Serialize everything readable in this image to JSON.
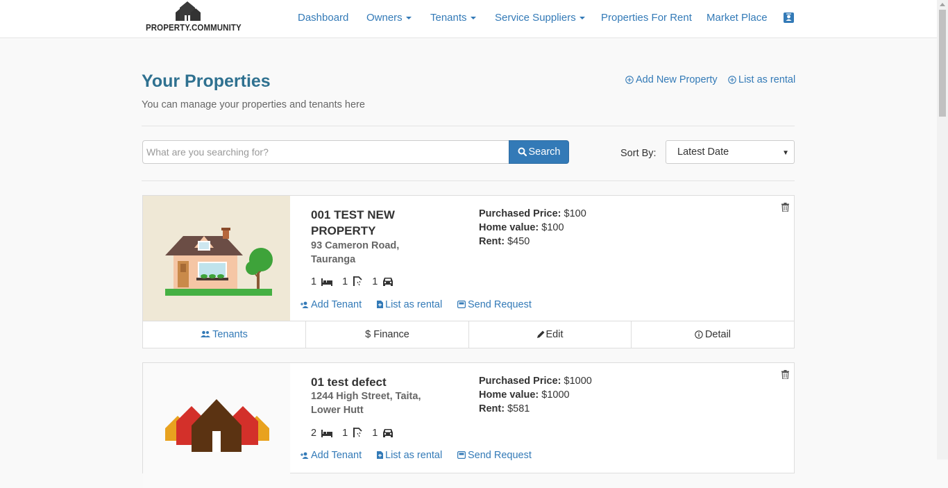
{
  "brand": {
    "name": "PROPERTY.COMMUNITY"
  },
  "nav": {
    "dashboard": "Dashboard",
    "owners": "Owners",
    "tenants": "Tenants",
    "service_suppliers": "Service Suppliers",
    "properties_for_rent": "Properties For Rent",
    "market_place": "Market Place",
    "profile_icon": "contact-card-icon"
  },
  "header": {
    "title": "Your Properties",
    "subtitle": "You can manage your properties and tenants here",
    "add_new_property": "Add New Property",
    "list_as_rental": "List as rental"
  },
  "search": {
    "placeholder": "What are you searching for?",
    "value": "",
    "button_label": "Search",
    "sort_label": "Sort By:",
    "sort_value": "Latest Date"
  },
  "properties": [
    {
      "name": "001 TEST NEW PROPERTY",
      "address": "93 Cameron Road, Tauranga",
      "purchased_price_label": "Purchased Price:",
      "purchased_price": "$100",
      "home_value_label": "Home value:",
      "home_value": "$100",
      "rent_label": "Rent:",
      "rent": "$450",
      "beds": "1",
      "baths": "1",
      "parking": "1",
      "actions": {
        "add_tenant": "Add Tenant",
        "list_as_rental": "List as rental",
        "send_request": "Send Request"
      },
      "footer": {
        "tenants": "Tenants",
        "finance": "Finance",
        "edit": "Edit",
        "detail": "Detail"
      },
      "image": "house-illustration"
    },
    {
      "name": "01 test defect",
      "address": "1244 High Street, Taita, Lower Hutt",
      "purchased_price_label": "Purchased Price:",
      "purchased_price": "$1000",
      "home_value_label": "Home value:",
      "home_value": "$1000",
      "rent_label": "Rent:",
      "rent": "$581",
      "beds": "2",
      "baths": "1",
      "parking": "1",
      "actions": {
        "add_tenant": "Add Tenant",
        "list_as_rental": "List as rental",
        "send_request": "Send Request"
      },
      "image": "houses-logo"
    }
  ],
  "colors": {
    "link": "#337ab7",
    "title": "#2f7190",
    "primary_button": "#337ab7"
  }
}
